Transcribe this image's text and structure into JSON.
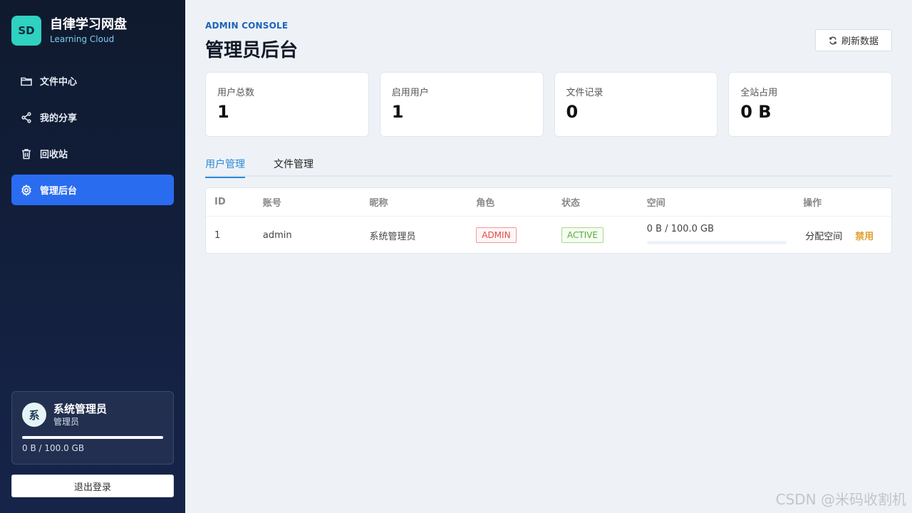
{
  "brand": {
    "logo_text": "SD",
    "title": "自律学习网盘",
    "subtitle": "Learning Cloud"
  },
  "nav": [
    {
      "label": "文件中心",
      "icon": "folder-icon"
    },
    {
      "label": "我的分享",
      "icon": "share-icon"
    },
    {
      "label": "回收站",
      "icon": "trash-icon"
    },
    {
      "label": "管理后台",
      "icon": "gear-icon",
      "active": true
    }
  ],
  "user": {
    "avatar_char": "系",
    "name": "系统管理员",
    "role": "管理员",
    "usage": "0 B / 100.0 GB",
    "usage_fraction": 0
  },
  "logout_label": "退出登录",
  "header": {
    "eyebrow": "ADMIN CONSOLE",
    "title": "管理员后台",
    "refresh_label": "刷新数据"
  },
  "stats": [
    {
      "label": "用户总数",
      "value": "1"
    },
    {
      "label": "启用用户",
      "value": "1"
    },
    {
      "label": "文件记录",
      "value": "0"
    },
    {
      "label": "全站占用",
      "value": "0 B"
    }
  ],
  "tabs": [
    {
      "label": "用户管理",
      "active": true
    },
    {
      "label": "文件管理",
      "active": false
    }
  ],
  "table": {
    "columns": [
      "ID",
      "账号",
      "昵称",
      "角色",
      "状态",
      "空间",
      "操作"
    ],
    "rows": [
      {
        "id": "1",
        "account": "admin",
        "nickname": "系统管理员",
        "role": "ADMIN",
        "status": "ACTIVE",
        "space": "0 B / 100.0 GB",
        "space_fraction": 0,
        "op_assign": "分配空间",
        "op_disable": "禁用"
      }
    ]
  },
  "watermark": "CSDN @米码收割机",
  "colors": {
    "accent": "#2a6cf0",
    "tab_active": "#2a8bd6",
    "logo_bg": "#2fd1c0",
    "disable": "#e0a030"
  }
}
